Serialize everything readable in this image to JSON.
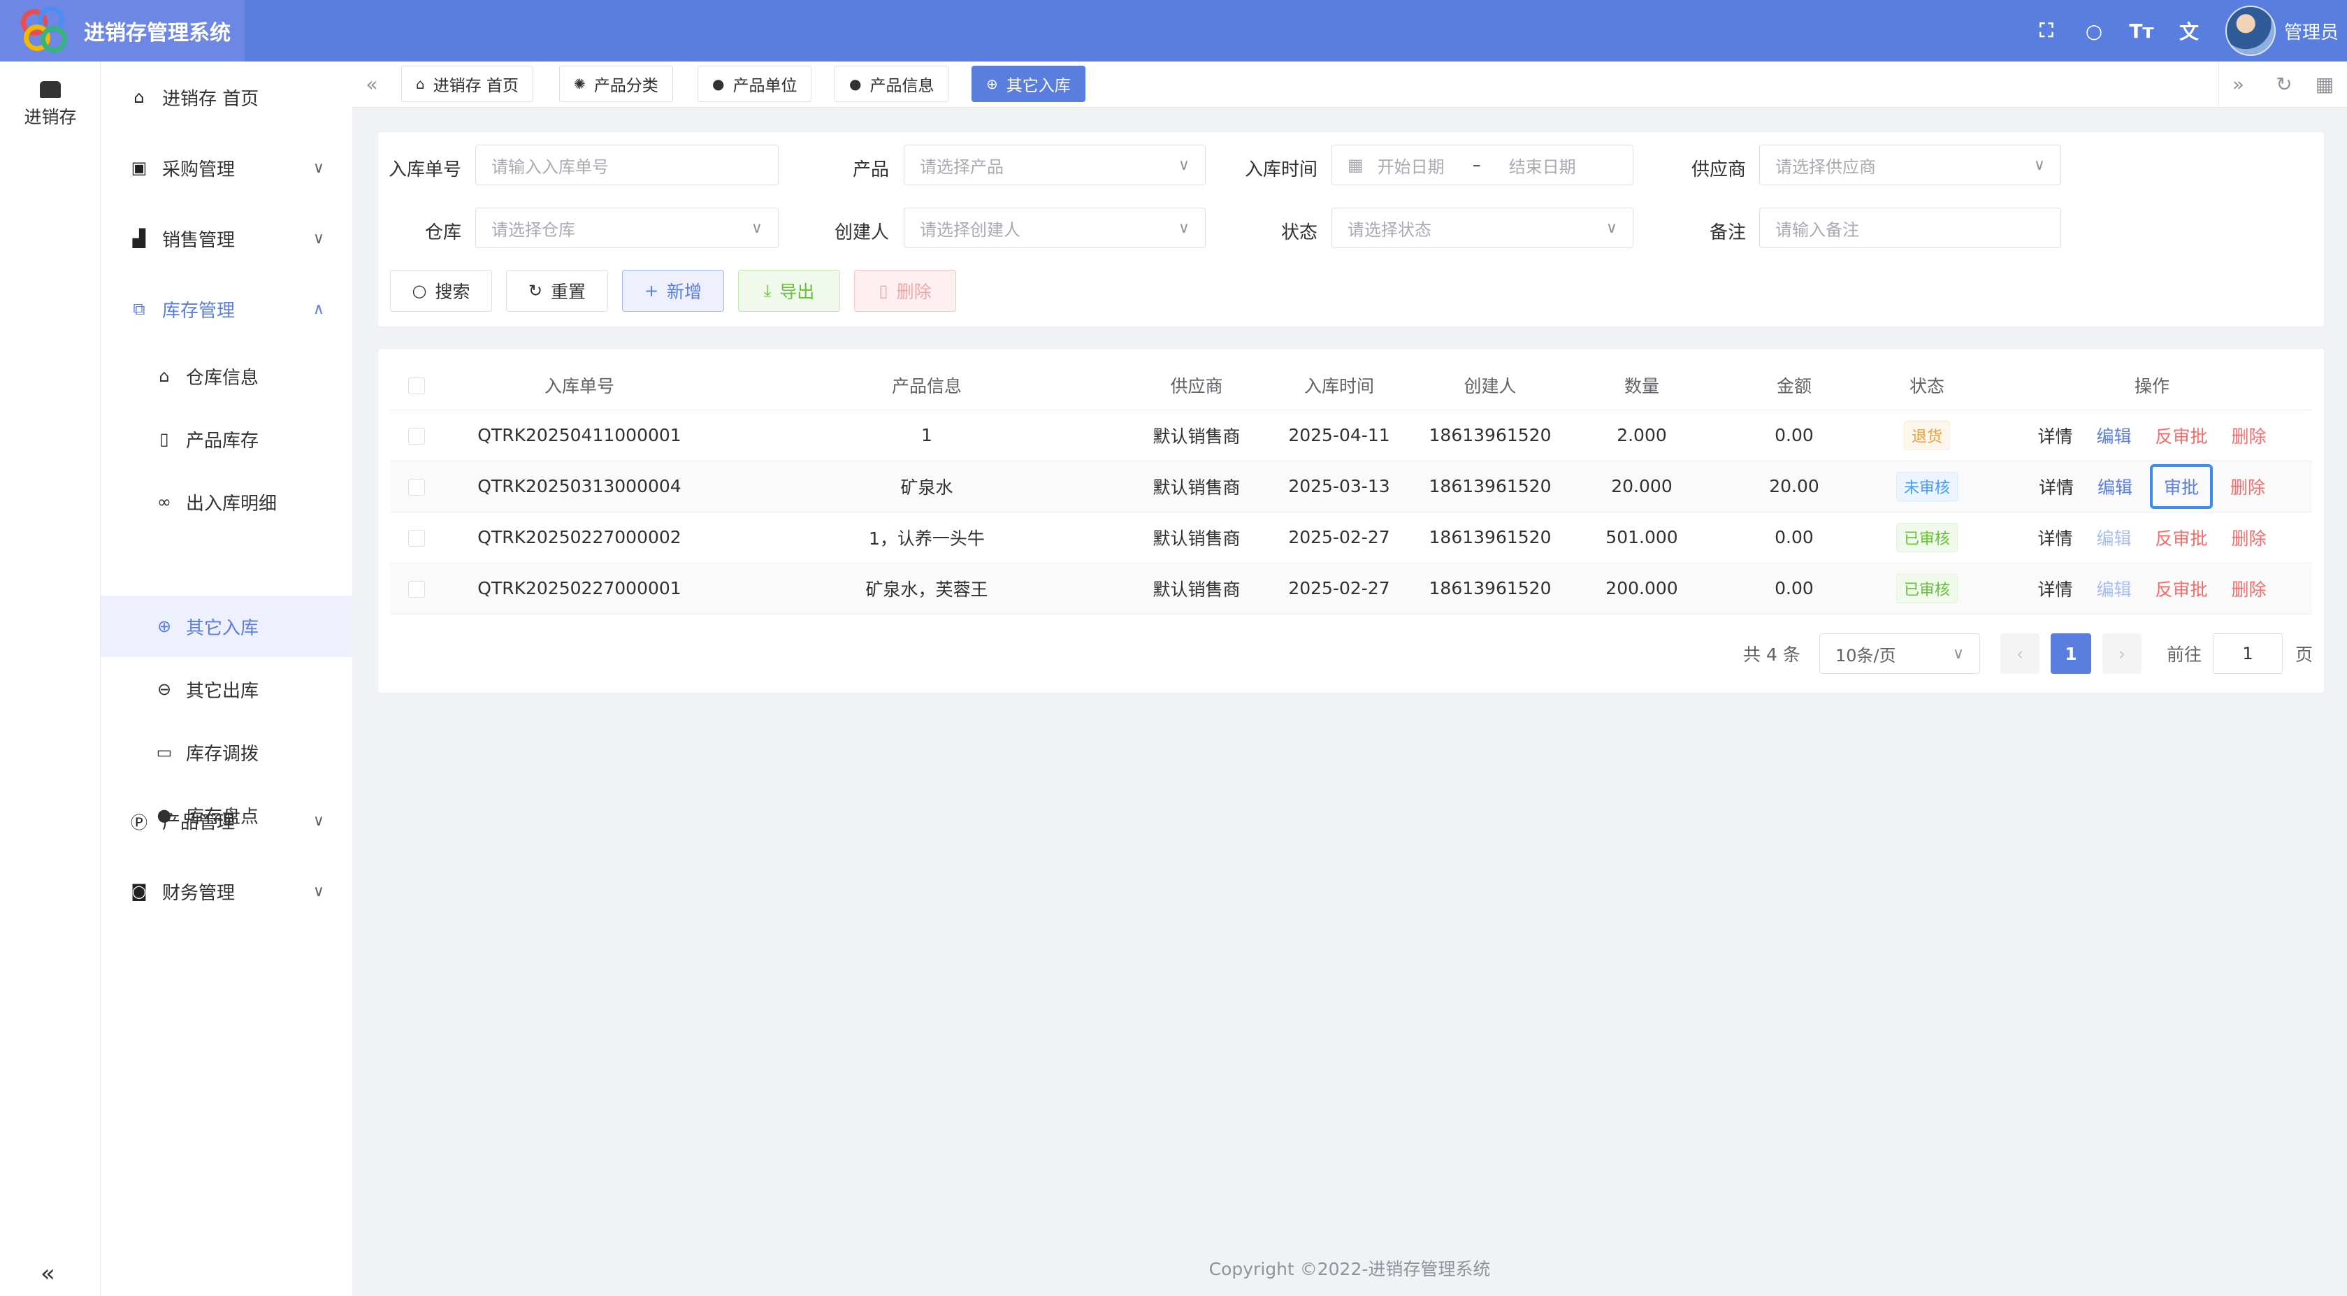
{
  "app": {
    "title": "进销存管理系统",
    "user": "管理员"
  },
  "header_icons": [
    "fullscreen-icon",
    "search-icon",
    "font-size-icon",
    "translate-icon"
  ],
  "rail": {
    "label": "进销存"
  },
  "sidebar": {
    "home": "进销存 首页",
    "purchase": "采购管理",
    "sales": "销售管理",
    "inventory": "库存管理",
    "sub": [
      "仓库信息",
      "产品库存",
      "出入库明细",
      "其它入库",
      "其它出库",
      "库存调拨",
      "库存盘点"
    ],
    "product": "产品管理",
    "finance": "财务管理"
  },
  "tabs": [
    "进销存 首页",
    "产品分类",
    "产品单位",
    "产品信息",
    "其它入库"
  ],
  "filters": {
    "order_no_label": "入库单号",
    "order_no_placeholder": "请输入入库单号",
    "product_label": "产品",
    "product_placeholder": "请选择产品",
    "time_label": "入库时间",
    "start_placeholder": "开始日期",
    "range_sep": "–",
    "end_placeholder": "结束日期",
    "supplier_label": "供应商",
    "supplier_placeholder": "请选择供应商",
    "warehouse_label": "仓库",
    "warehouse_placeholder": "请选择仓库",
    "creator_label": "创建人",
    "creator_placeholder": "请选择创建人",
    "status_label": "状态",
    "status_placeholder": "请选择状态",
    "remark_label": "备注",
    "remark_placeholder": "请输入备注"
  },
  "actions": {
    "search": "搜索",
    "reset": "重置",
    "add": "新增",
    "export": "导出",
    "delete": "删除"
  },
  "table": {
    "headers": [
      "入库单号",
      "产品信息",
      "供应商",
      "入库时间",
      "创建人",
      "数量",
      "金额",
      "状态",
      "操作"
    ],
    "rows": [
      {
        "no": "QTRK20250411000001",
        "product": "1",
        "supplier": "默认销售商",
        "date": "2025-04-11",
        "creator": "18613961520",
        "qty": "2.000",
        "amount": "0.00",
        "status": "退货"
      },
      {
        "no": "QTRK20250313000004",
        "product": "矿泉水",
        "supplier": "默认销售商",
        "date": "2025-03-13",
        "creator": "18613961520",
        "qty": "20.000",
        "amount": "20.00",
        "status": "未审核"
      },
      {
        "no": "QTRK20250227000002",
        "product": "1，认养一头牛",
        "supplier": "默认销售商",
        "date": "2025-02-27",
        "creator": "18613961520",
        "qty": "501.000",
        "amount": "0.00",
        "status": "已审核"
      },
      {
        "no": "QTRK20250227000001",
        "product": "矿泉水，芙蓉王",
        "supplier": "默认销售商",
        "date": "2025-02-27",
        "creator": "18613961520",
        "qty": "200.000",
        "amount": "0.00",
        "status": "已审核"
      }
    ],
    "ops": {
      "detail": "详情",
      "edit": "编辑",
      "unapprove": "反审批",
      "approve": "审批",
      "delete": "删除"
    }
  },
  "pagination": {
    "total": "共 4 条",
    "page_size": "10条/页",
    "current": "1",
    "goto_label": "前往",
    "goto_value": "1",
    "page_suffix": "页"
  },
  "footer": "Copyright ©2022-进销存管理系统"
}
